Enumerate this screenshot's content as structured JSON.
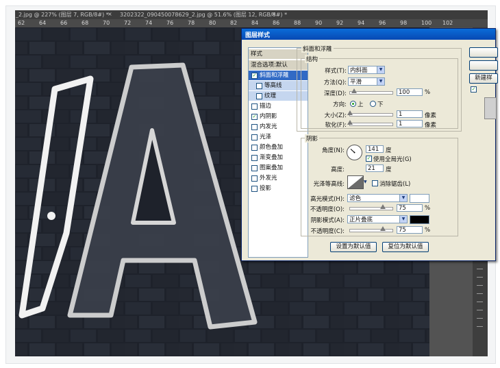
{
  "tabs": {
    "tab1": "_2.jpg @ 227% (图层 7, RGB/8#) *",
    "tab2": "3202322_090450078629_2.jpg @ 51.6% (图层 12, RGB/8#) *",
    "close": "×"
  },
  "ruler": [
    "62",
    "64",
    "66",
    "68",
    "70",
    "72",
    "74",
    "76",
    "78",
    "80",
    "82",
    "84",
    "86",
    "88",
    "90",
    "92",
    "94",
    "96",
    "98",
    "100",
    "102"
  ],
  "ps_icon": "⌂",
  "dialog": {
    "title": "图层样式",
    "left_list": {
      "header1": "样式",
      "header2": "混合选项:默认",
      "items": [
        {
          "label": "斜面和浮雕",
          "checked": "✓"
        },
        {
          "label": "等高线",
          "checked": ""
        },
        {
          "label": "纹理",
          "checked": ""
        },
        {
          "label": "描边",
          "checked": ""
        },
        {
          "label": "内阴影",
          "checked": "✓"
        },
        {
          "label": "内发光",
          "checked": ""
        },
        {
          "label": "光泽",
          "checked": ""
        },
        {
          "label": "颜色叠加",
          "checked": ""
        },
        {
          "label": "渐变叠加",
          "checked": ""
        },
        {
          "label": "图案叠加",
          "checked": ""
        },
        {
          "label": "外发光",
          "checked": ""
        },
        {
          "label": "投影",
          "checked": ""
        }
      ]
    },
    "bevel": {
      "group_title": "斜面和浮雕",
      "structure_title": "结构",
      "style_label": "样式(T):",
      "style_value": "内斜面",
      "technique_label": "方法(Q):",
      "technique_value": "平滑",
      "depth_label": "深度(D):",
      "depth_value": "100",
      "depth_unit": "%",
      "depth_fraction": 0.1,
      "direction_label": "方向:",
      "direction_up": "上",
      "direction_down": "下",
      "size_label": "大小(Z):",
      "size_value": "1",
      "size_unit": "像素",
      "size_fraction": 0.0,
      "soften_label": "软化(F):",
      "soften_value": "1",
      "soften_unit": "像素",
      "soften_fraction": 0.0
    },
    "shading": {
      "group_title": "阴影",
      "angle_label": "角度(N):",
      "angle_value": "141",
      "angle_unit": "度",
      "global_light_label": "使用全局光(G)",
      "global_light_checked": "✓",
      "altitude_label": "高度:",
      "altitude_value": "21",
      "altitude_unit": "度",
      "gloss_label": "光泽等高线:",
      "antialias_label": "消除锯齿(L)",
      "highlight_mode_label": "高光模式(H):",
      "highlight_mode_value": "滤色",
      "highlight_color": "#ffffff",
      "highlight_opacity_label": "不透明度(O):",
      "highlight_opacity_value": "75",
      "highlight_opacity_unit": "%",
      "highlight_opacity_fraction": 0.75,
      "shadow_mode_label": "阴影模式(A):",
      "shadow_mode_value": "正片叠底",
      "shadow_color": "#000000",
      "shadow_opacity_label": "不透明度(C):",
      "shadow_opacity_value": "75",
      "shadow_opacity_unit": "%",
      "shadow_opacity_fraction": 0.75
    },
    "buttons": {
      "make_default": "设置为默认值",
      "reset_default": "复位为默认值",
      "new_style": "新建样"
    }
  }
}
